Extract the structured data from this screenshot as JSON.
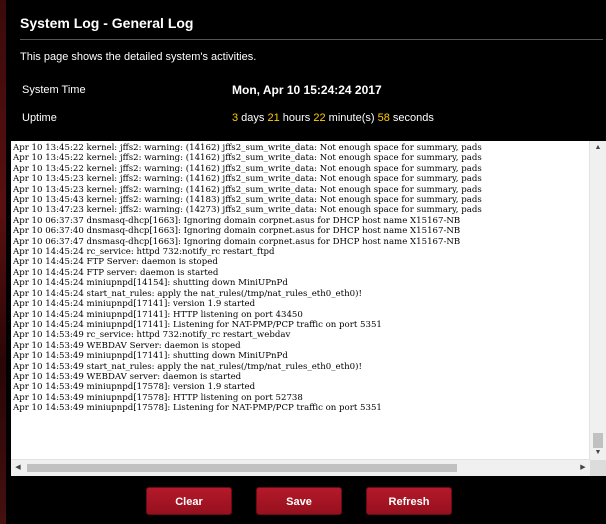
{
  "page": {
    "title": "System Log - General Log",
    "description": "This page shows the detailed system's activities."
  },
  "system_time": {
    "label": "System Time",
    "value": "Mon, Apr 10 15:24:24 2017"
  },
  "uptime": {
    "label": "Uptime",
    "days": "3",
    "days_label": " days ",
    "hours": "21",
    "hours_label": " hours ",
    "minutes": "22",
    "minutes_label": " minute(s) ",
    "seconds": "58",
    "seconds_label": " seconds"
  },
  "log": {
    "text": "Apr 10 13:45:22 kernel: jffs2: warning: (14162) jffs2_sum_write_data: Not enough space for summary, pads\nApr 10 13:45:22 kernel: jffs2: warning: (14162) jffs2_sum_write_data: Not enough space for summary, pads\nApr 10 13:45:22 kernel: jffs2: warning: (14162) jffs2_sum_write_data: Not enough space for summary, pads\nApr 10 13:45:23 kernel: jffs2: warning: (14162) jffs2_sum_write_data: Not enough space for summary, pads\nApr 10 13:45:23 kernel: jffs2: warning: (14162) jffs2_sum_write_data: Not enough space for summary, pads\nApr 10 13:45:43 kernel: jffs2: warning: (14183) jffs2_sum_write_data: Not enough space for summary, pads\nApr 10 13:47:23 kernel: jffs2: warning: (14273) jffs2_sum_write_data: Not enough space for summary, pads\nApr 10 06:37:37 dnsmasq-dhcp[1663]: Ignoring domain corpnet.asus for DHCP host name X15167-NB\nApr 10 06:37:40 dnsmasq-dhcp[1663]: Ignoring domain corpnet.asus for DHCP host name X15167-NB\nApr 10 06:37:47 dnsmasq-dhcp[1663]: Ignoring domain corpnet.asus for DHCP host name X15167-NB\nApr 10 14:45:24 rc_service: httpd 732:notify_rc restart_ftpd\nApr 10 14:45:24 FTP Server: daemon is stoped\nApr 10 14:45:24 FTP server: daemon is started\nApr 10 14:45:24 miniupnpd[14154]: shutting down MiniUPnPd\nApr 10 14:45:24 start_nat_rules: apply the nat_rules(/tmp/nat_rules_eth0_eth0)!\nApr 10 14:45:24 miniupnpd[17141]: version 1.9 started\nApr 10 14:45:24 miniupnpd[17141]: HTTP listening on port 43450\nApr 10 14:45:24 miniupnpd[17141]: Listening for NAT-PMP/PCP traffic on port 5351\nApr 10 14:53:49 rc_service: httpd 732:notify_rc restart_webdav\nApr 10 14:53:49 WEBDAV Server: daemon is stoped\nApr 10 14:53:49 miniupnpd[17141]: shutting down MiniUPnPd\nApr 10 14:53:49 start_nat_rules: apply the nat_rules(/tmp/nat_rules_eth0_eth0)!\nApr 10 14:53:49 WEBDAV server: daemon is started\nApr 10 14:53:49 miniupnpd[17578]: version 1.9 started\nApr 10 14:53:49 miniupnpd[17578]: HTTP listening on port 52738\nApr 10 14:53:49 miniupnpd[17578]: Listening for NAT-PMP/PCP traffic on port 5351"
  },
  "buttons": {
    "clear": "Clear",
    "save": "Save",
    "refresh": "Refresh"
  },
  "colors": {
    "accent_red": "#a8141f",
    "highlight_yellow": "#ffcc00",
    "background": "#000000"
  },
  "icons": {
    "scroll_up": "▲",
    "scroll_down": "▼",
    "scroll_left": "◀",
    "scroll_right": "▶"
  }
}
